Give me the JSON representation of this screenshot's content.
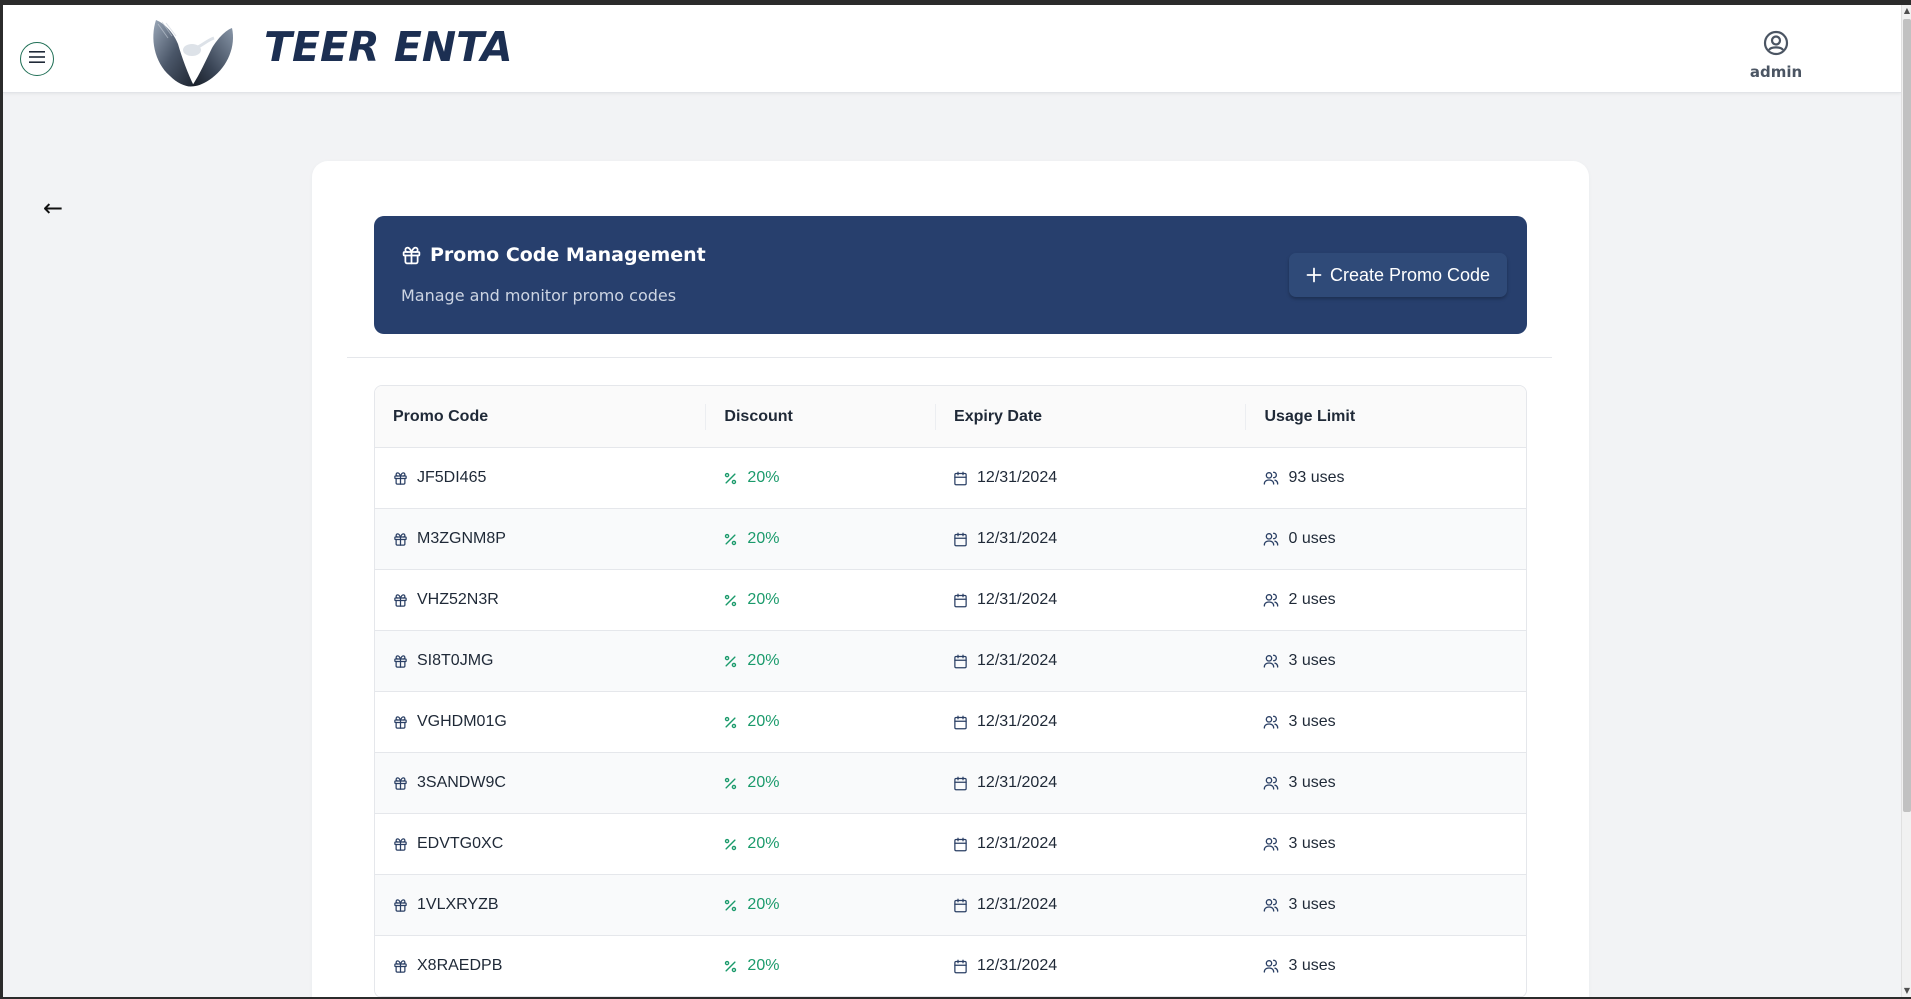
{
  "header": {
    "brand": "TEER ENTA",
    "user_label": "admin"
  },
  "nav": {
    "back_symbol": "←"
  },
  "banner": {
    "title": "Promo Code Management",
    "subtitle": "Manage and monitor promo codes",
    "create_label": "Create Promo Code"
  },
  "table": {
    "headers": [
      "Promo Code",
      "Discount",
      "Expiry Date",
      "Usage Limit"
    ],
    "rows": [
      {
        "code": "JF5DI465",
        "discount": "20%",
        "expiry": "12/31/2024",
        "usage": "93 uses"
      },
      {
        "code": "M3ZGNM8P",
        "discount": "20%",
        "expiry": "12/31/2024",
        "usage": "0 uses"
      },
      {
        "code": "VHZ52N3R",
        "discount": "20%",
        "expiry": "12/31/2024",
        "usage": "2 uses"
      },
      {
        "code": "SI8T0JMG",
        "discount": "20%",
        "expiry": "12/31/2024",
        "usage": "3 uses"
      },
      {
        "code": "VGHDM01G",
        "discount": "20%",
        "expiry": "12/31/2024",
        "usage": "3 uses"
      },
      {
        "code": "3SANDW9C",
        "discount": "20%",
        "expiry": "12/31/2024",
        "usage": "3 uses"
      },
      {
        "code": "EDVTG0XC",
        "discount": "20%",
        "expiry": "12/31/2024",
        "usage": "3 uses"
      },
      {
        "code": "1VLXRYZB",
        "discount": "20%",
        "expiry": "12/31/2024",
        "usage": "3 uses"
      },
      {
        "code": "X8RAEDPB",
        "discount": "20%",
        "expiry": "12/31/2024",
        "usage": "3 uses"
      }
    ]
  },
  "icons": {
    "menu": "hamburger-menu-icon",
    "logo": "bird-wings-logo",
    "user": "user-circle-icon",
    "gift": "gift-icon",
    "percent": "percent-icon",
    "calendar": "calendar-icon",
    "users": "users-icon",
    "plus": "plus-icon"
  },
  "colors": {
    "banner": "#273f6d",
    "brand_text": "#1c2f52",
    "discount": "#1a9a6b",
    "menu_ring": "#1f6f55"
  }
}
